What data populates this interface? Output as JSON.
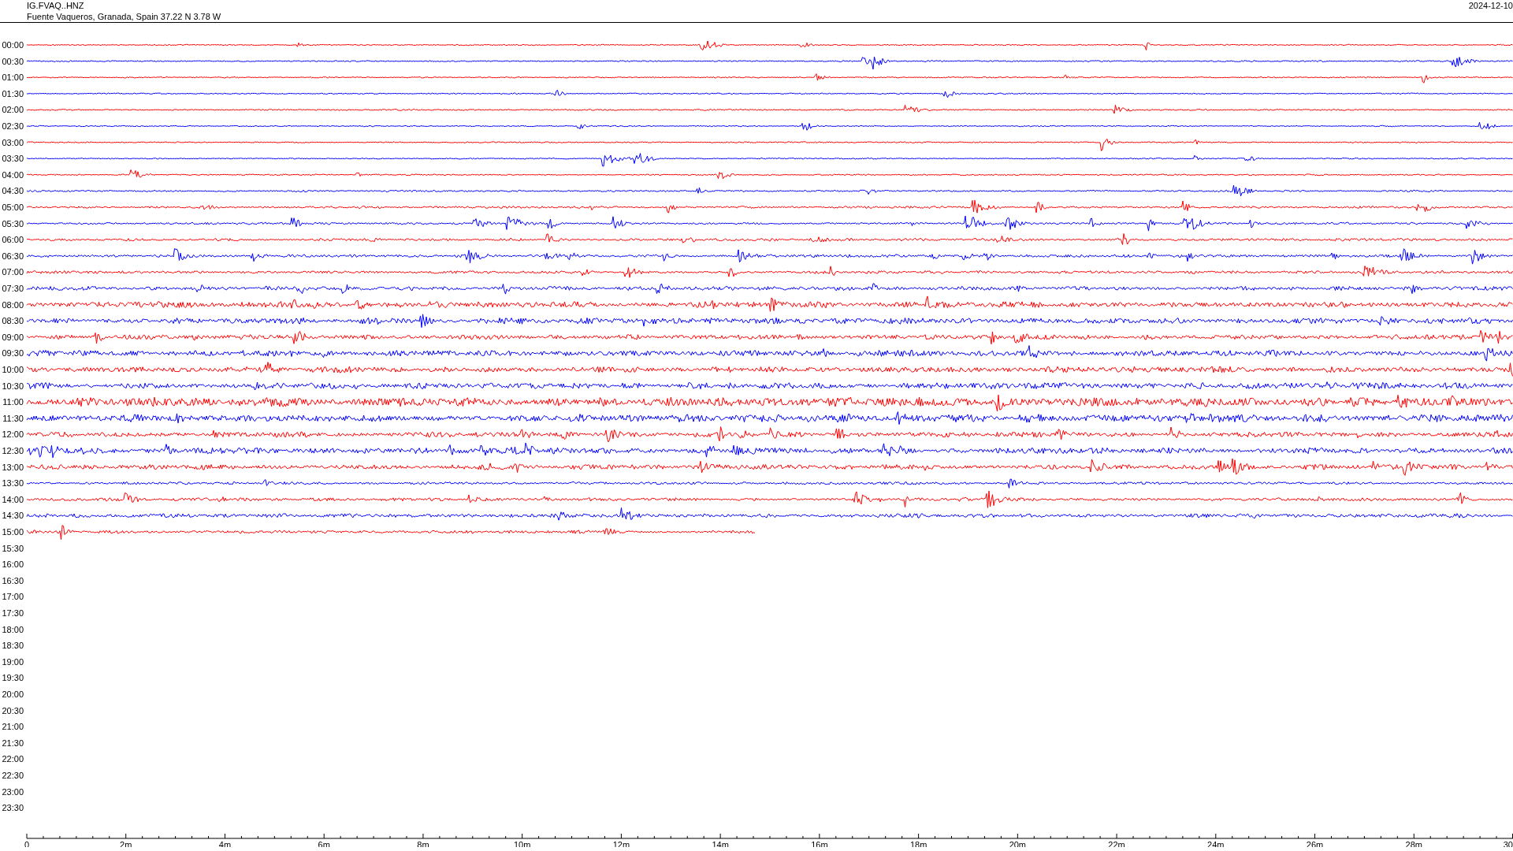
{
  "header": {
    "station": "IG.FVAQ..HNZ",
    "location": "Fuente Vaqueros, Granada, Spain  37.22 N 3.78 W",
    "date": "2024-12-10"
  },
  "rows": [
    {
      "label": "00:00",
      "kind": "trace",
      "color": "#ff0000"
    },
    {
      "label": "00:30",
      "kind": "trace",
      "color": "#0000ff"
    },
    {
      "label": "01:00",
      "kind": "trace",
      "color": "#ff0000"
    },
    {
      "label": "01:30",
      "kind": "trace",
      "color": "#0000ff"
    },
    {
      "label": "02:00",
      "kind": "trace",
      "color": "#ff0000"
    },
    {
      "label": "02:30",
      "kind": "trace",
      "color": "#0000ff"
    },
    {
      "label": "03:00",
      "kind": "trace",
      "color": "#ff0000"
    },
    {
      "label": "03:30",
      "kind": "trace",
      "color": "#0000ff"
    },
    {
      "label": "04:00",
      "kind": "trace",
      "color": "#ff0000"
    },
    {
      "label": "04:30",
      "kind": "trace",
      "color": "#0000ff"
    },
    {
      "label": "05:00",
      "kind": "trace",
      "color": "#ff0000"
    },
    {
      "label": "05:30",
      "kind": "trace",
      "color": "#0000ff"
    },
    {
      "label": "06:00",
      "kind": "trace",
      "color": "#ff0000"
    },
    {
      "label": "06:30",
      "kind": "trace",
      "color": "#0000ff"
    },
    {
      "label": "07:00",
      "kind": "trace",
      "color": "#ff0000"
    },
    {
      "label": "07:30",
      "kind": "trace",
      "color": "#0000ff"
    },
    {
      "label": "08:00",
      "kind": "trace",
      "color": "#ff0000"
    },
    {
      "label": "08:30",
      "kind": "trace",
      "color": "#0000ff"
    },
    {
      "label": "09:00",
      "kind": "trace",
      "color": "#ff0000"
    },
    {
      "label": "09:30",
      "kind": "trace",
      "color": "#0000ff"
    },
    {
      "label": "10:00",
      "kind": "trace",
      "color": "#ff0000"
    },
    {
      "label": "10:30",
      "kind": "trace",
      "color": "#0000ff"
    },
    {
      "label": "11:00",
      "kind": "trace",
      "color": "#ff0000"
    },
    {
      "label": "11:30",
      "kind": "trace",
      "color": "#0000ff"
    },
    {
      "label": "12:00",
      "kind": "trace",
      "color": "#ff0000"
    },
    {
      "label": "12:30",
      "kind": "trace",
      "color": "#0000ff"
    },
    {
      "label": "13:00",
      "kind": "trace",
      "color": "#ff0000"
    },
    {
      "label": "13:30",
      "kind": "trace",
      "color": "#0000ff"
    },
    {
      "label": "14:00",
      "kind": "trace",
      "color": "#ff0000"
    },
    {
      "label": "14:30",
      "kind": "trace",
      "color": "#0000ff"
    },
    {
      "label": "15:00",
      "kind": "partial",
      "color": "#ff0000"
    },
    {
      "label": "15:30",
      "kind": "empty"
    },
    {
      "label": "16:00",
      "kind": "empty"
    },
    {
      "label": "16:30",
      "kind": "empty"
    },
    {
      "label": "17:00",
      "kind": "empty"
    },
    {
      "label": "17:30",
      "kind": "empty"
    },
    {
      "label": "18:00",
      "kind": "empty"
    },
    {
      "label": "18:30",
      "kind": "empty"
    },
    {
      "label": "19:00",
      "kind": "empty"
    },
    {
      "label": "19:30",
      "kind": "empty"
    },
    {
      "label": "20:00",
      "kind": "empty"
    },
    {
      "label": "20:30",
      "kind": "empty"
    },
    {
      "label": "21:00",
      "kind": "empty"
    },
    {
      "label": "21:30",
      "kind": "empty"
    },
    {
      "label": "22:00",
      "kind": "empty"
    },
    {
      "label": "22:30",
      "kind": "empty"
    },
    {
      "label": "23:00",
      "kind": "empty"
    },
    {
      "label": "23:30",
      "kind": "empty"
    }
  ],
  "axis": {
    "ticks": [
      "0",
      "2m",
      "4m",
      "6m",
      "8m",
      "10m",
      "12m",
      "14m",
      "16m",
      "18m",
      "20m",
      "22m",
      "24m",
      "26m",
      "28m",
      "30"
    ]
  }
}
